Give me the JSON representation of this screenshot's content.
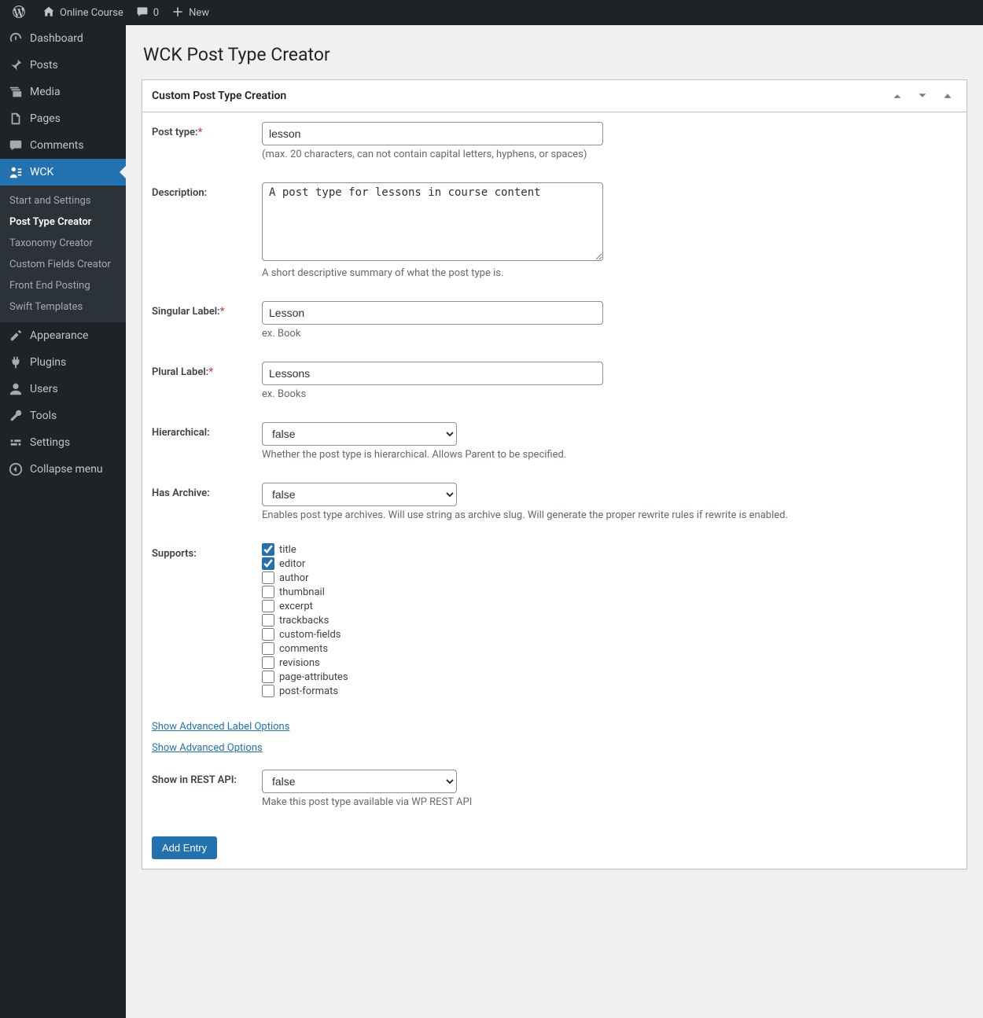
{
  "topbar": {
    "site_name": "Online Course",
    "comments_count": "0",
    "new_label": "New"
  },
  "sidebar": {
    "items": [
      {
        "label": "Dashboard"
      },
      {
        "label": "Posts"
      },
      {
        "label": "Media"
      },
      {
        "label": "Pages"
      },
      {
        "label": "Comments"
      },
      {
        "label": "WCK"
      },
      {
        "label": "Appearance"
      },
      {
        "label": "Plugins"
      },
      {
        "label": "Users"
      },
      {
        "label": "Tools"
      },
      {
        "label": "Settings"
      },
      {
        "label": "Collapse menu"
      }
    ],
    "submenu": [
      {
        "label": "Start and Settings"
      },
      {
        "label": "Post Type Creator"
      },
      {
        "label": "Taxonomy Creator"
      },
      {
        "label": "Custom Fields Creator"
      },
      {
        "label": "Front End Posting"
      },
      {
        "label": "Swift Templates"
      }
    ]
  },
  "page": {
    "title": "WCK Post Type Creator"
  },
  "panel": {
    "title": "Custom Post Type Creation"
  },
  "form": {
    "post_type": {
      "label": "Post type:",
      "value": "lesson",
      "hint": "(max. 20 characters, can not contain capital letters, hyphens, or spaces)"
    },
    "description": {
      "label": "Description:",
      "value": "A post type for lessons in course content",
      "hint": "A short descriptive summary of what the post type is."
    },
    "singular": {
      "label": "Singular Label:",
      "value": "Lesson",
      "hint": "ex. Book"
    },
    "plural": {
      "label": "Plural Label:",
      "value": "Lessons",
      "hint": "ex. Books"
    },
    "hierarchical": {
      "label": "Hierarchical:",
      "value": "false",
      "hint": "Whether the post type is hierarchical. Allows Parent to be specified."
    },
    "has_archive": {
      "label": "Has Archive:",
      "value": "false",
      "hint": "Enables post type archives. Will use string as archive slug. Will generate the proper rewrite rules if rewrite is enabled."
    },
    "supports": {
      "label": "Supports:",
      "options": [
        {
          "label": "title",
          "checked": true
        },
        {
          "label": "editor",
          "checked": true
        },
        {
          "label": "author",
          "checked": false
        },
        {
          "label": "thumbnail",
          "checked": false
        },
        {
          "label": "excerpt",
          "checked": false
        },
        {
          "label": "trackbacks",
          "checked": false
        },
        {
          "label": "custom-fields",
          "checked": false
        },
        {
          "label": "comments",
          "checked": false
        },
        {
          "label": "revisions",
          "checked": false
        },
        {
          "label": "page-attributes",
          "checked": false
        },
        {
          "label": "post-formats",
          "checked": false
        }
      ]
    },
    "adv_labels_link": "Show Advanced Label Options",
    "adv_options_link": "Show Advanced Options",
    "rest": {
      "label": "Show in REST API:",
      "value": "false",
      "hint": "Make this post type available via WP REST API"
    },
    "submit_label": "Add Entry"
  }
}
